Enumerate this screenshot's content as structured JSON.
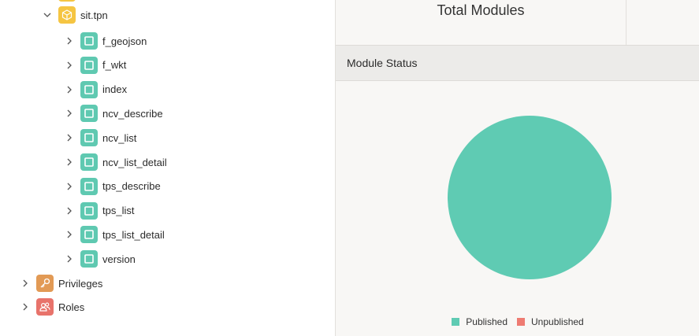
{
  "tree": {
    "schema": {
      "label": "sit.tpn"
    },
    "modules": [
      {
        "label": "f_geojson"
      },
      {
        "label": "f_wkt"
      },
      {
        "label": "index"
      },
      {
        "label": "ncv_describe"
      },
      {
        "label": "ncv_list"
      },
      {
        "label": "ncv_list_detail"
      },
      {
        "label": "tps_describe"
      },
      {
        "label": "tps_list"
      },
      {
        "label": "tps_list_detail"
      },
      {
        "label": "version"
      }
    ],
    "privileges": {
      "label": "Privileges"
    },
    "roles": {
      "label": "Roles"
    }
  },
  "panel": {
    "total_title": "Total Modules",
    "status_title": "Module Status"
  },
  "colors": {
    "published": "#5fcbb3",
    "unpublished": "#ee7b72"
  },
  "chart_data": {
    "type": "pie",
    "title": "",
    "categories": [
      "Published",
      "Unpublished"
    ],
    "values": [
      10,
      0
    ],
    "legend": "bottom"
  }
}
